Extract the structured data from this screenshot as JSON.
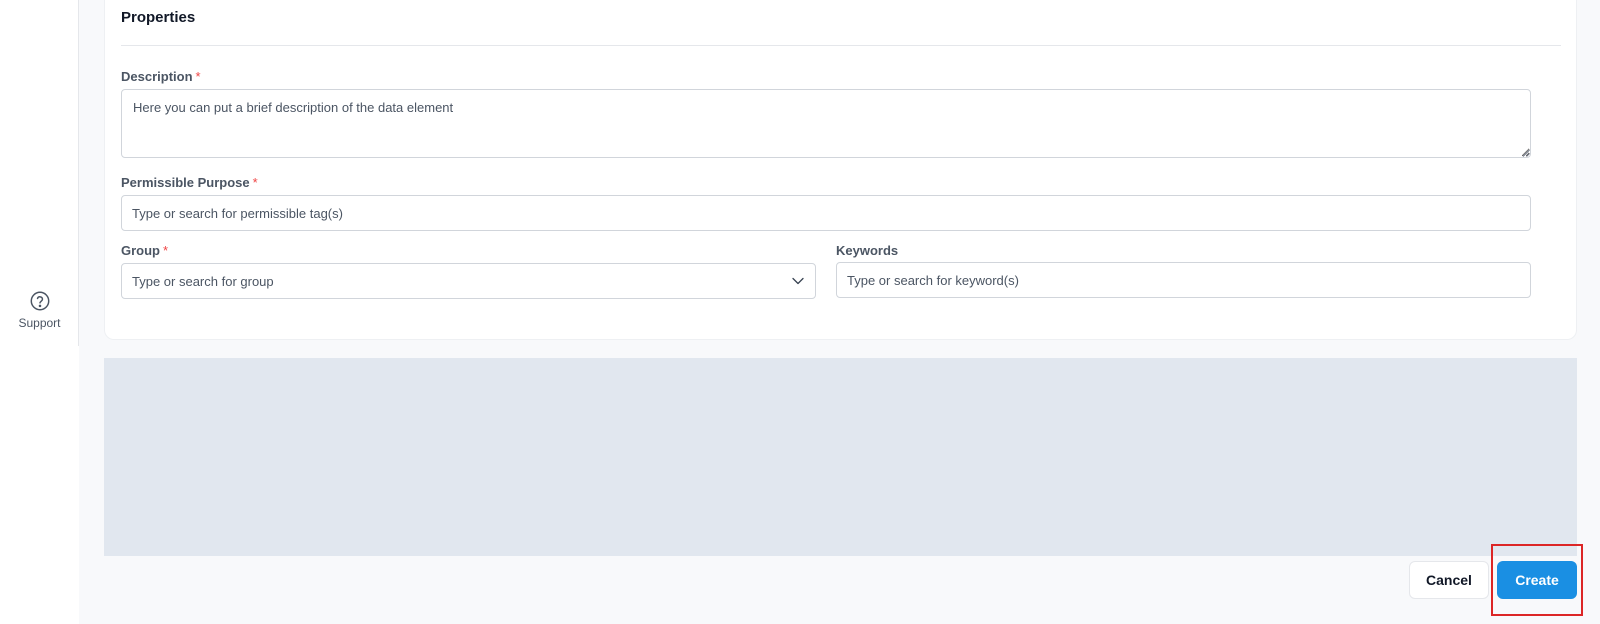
{
  "sidebar": {
    "support_label": "Support",
    "support_icon": "help-circle-icon"
  },
  "properties": {
    "title": "Properties",
    "required_marker": "*",
    "description": {
      "label": "Description",
      "placeholder": "Here you can put a brief description of the data element",
      "value": ""
    },
    "permissible_purpose": {
      "label": "Permissible Purpose",
      "placeholder": "Type or search for permissible tag(s)",
      "value": ""
    },
    "group": {
      "label": "Group",
      "placeholder": "Type or search for group",
      "value": "",
      "icon": "chevron-down-icon"
    },
    "keywords": {
      "label": "Keywords",
      "placeholder": "Type or search for keyword(s)",
      "value": ""
    }
  },
  "footer": {
    "cancel_label": "Cancel",
    "create_label": "Create"
  },
  "colors": {
    "primary": "#1a8fe3",
    "required": "#ef4444",
    "highlight": "#dc2626",
    "panel": "#e1e7ef"
  }
}
